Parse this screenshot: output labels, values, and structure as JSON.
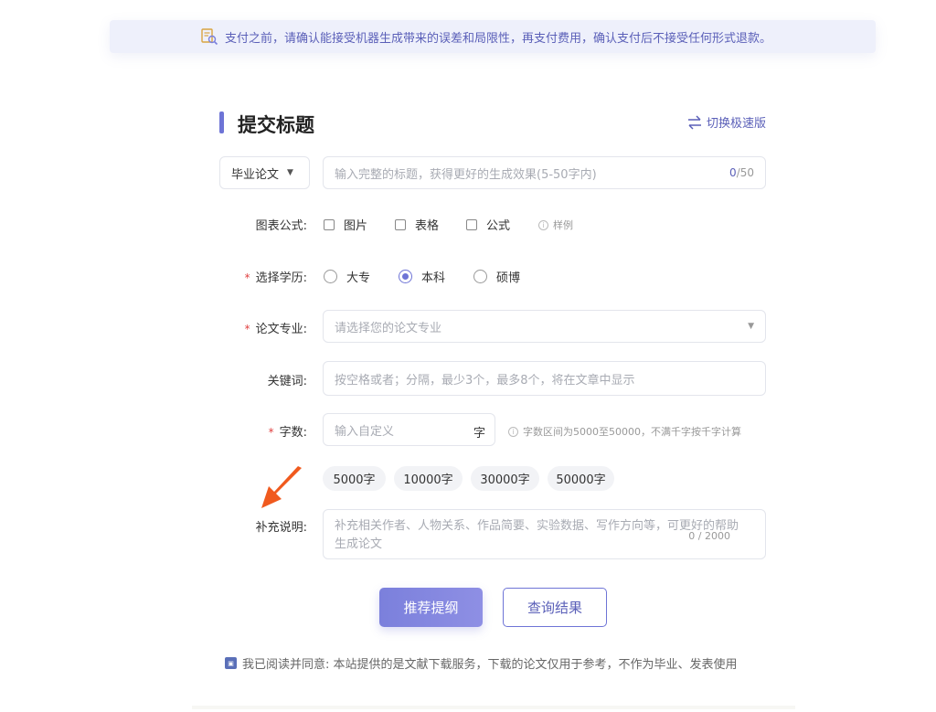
{
  "notice": {
    "text": "支付之前，请确认能接受机器生成带来的误差和局限性，再支付费用，确认支付后不接受任何形式退款。",
    "icon": "search-document-icon"
  },
  "header": {
    "title": "提交标题",
    "switch_label": "切换极速版",
    "switch_icon": "swap-arrows-icon"
  },
  "type_select": {
    "value": "毕业论文"
  },
  "title_input": {
    "placeholder": "输入完整的标题，获得更好的生成效果(5-50字内)",
    "count": "0",
    "max": "/50"
  },
  "chart_formula": {
    "label": "图表公式:",
    "options": [
      {
        "label": "图片",
        "checked": false
      },
      {
        "label": "表格",
        "checked": false
      },
      {
        "label": "公式",
        "checked": false
      }
    ],
    "example_label": "样例"
  },
  "education": {
    "required": "*",
    "label": "选择学历:",
    "options": [
      {
        "label": "大专",
        "selected": false
      },
      {
        "label": "本科",
        "selected": true
      },
      {
        "label": "硕博",
        "selected": false
      }
    ]
  },
  "major": {
    "required": "*",
    "label": "论文专业:",
    "placeholder": "请选择您的论文专业"
  },
  "keywords": {
    "label": "关键词:",
    "placeholder": "按空格或者；分隔，最少3个，最多8个，将在文章中显示"
  },
  "word_count": {
    "required": "*",
    "label": "字数:",
    "placeholder": "输入自定义",
    "unit": "字",
    "hint": "字数区间为5000至50000，不满千字按千字计算",
    "presets": [
      "5000字",
      "10000字",
      "30000字",
      "50000字"
    ]
  },
  "remark": {
    "label": "补充说明:",
    "placeholder_line1": "补充相关作者、人物关系、作品简要、实验数据、写作方向等，可更好的帮助",
    "placeholder_line2": "生成论文",
    "counter": "0 / 2000"
  },
  "actions": {
    "primary": "推荐提纲",
    "secondary": "查询结果"
  },
  "agreement": {
    "text": "我已阅读并同意: 本站提供的是文献下载服务，下载的论文仅用于参考，不作为毕业、发表使用"
  },
  "colors": {
    "accent": "#6e74d6",
    "arrow": "#f05a1e",
    "required": "#e04040"
  }
}
